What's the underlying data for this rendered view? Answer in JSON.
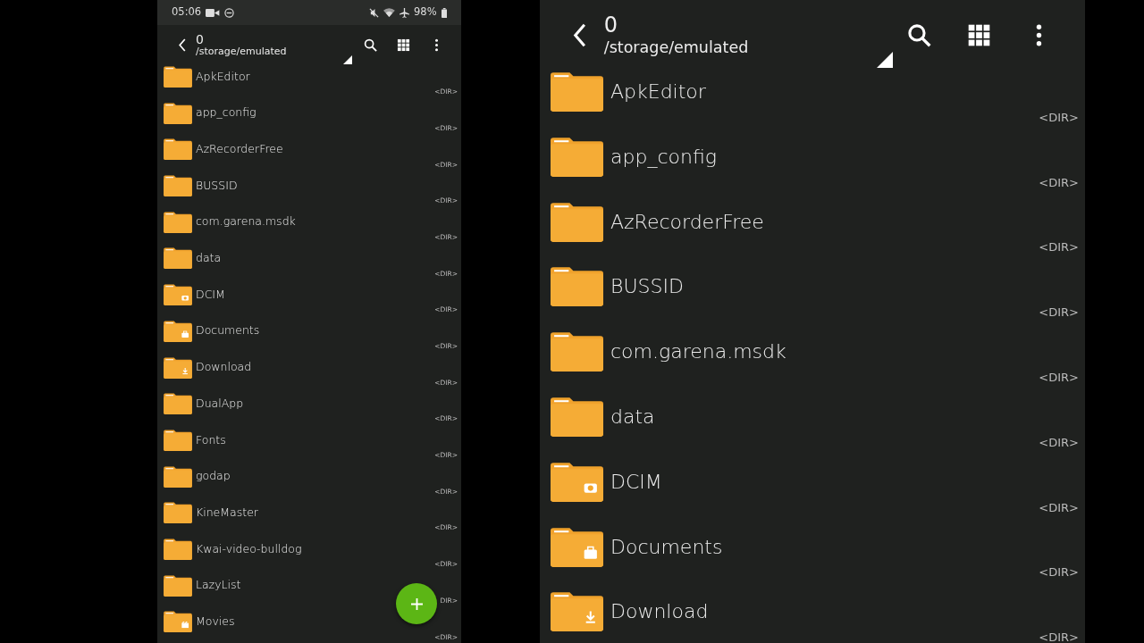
{
  "left_panel": {
    "status_bar": {
      "time": "05:06",
      "battery": "98%"
    },
    "toolbar": {
      "title": "0",
      "path": "/storage/emulated"
    },
    "items": [
      {
        "name": "ApkEditor",
        "badge": "<DIR>",
        "kind": "plain"
      },
      {
        "name": "app_config",
        "badge": "<DIR>",
        "kind": "plain"
      },
      {
        "name": "AzRecorderFree",
        "badge": "<DIR>",
        "kind": "plain"
      },
      {
        "name": "BUSSID",
        "badge": "<DIR>",
        "kind": "plain"
      },
      {
        "name": "com.garena.msdk",
        "badge": "<DIR>",
        "kind": "plain"
      },
      {
        "name": "data",
        "badge": "<DIR>",
        "kind": "plain"
      },
      {
        "name": "DCIM",
        "badge": "<DIR>",
        "kind": "camera"
      },
      {
        "name": "Documents",
        "badge": "<DIR>",
        "kind": "briefcase"
      },
      {
        "name": "Download",
        "badge": "<DIR>",
        "kind": "download"
      },
      {
        "name": "DualApp",
        "badge": "<DIR>",
        "kind": "plain"
      },
      {
        "name": "Fonts",
        "badge": "<DIR>",
        "kind": "plain"
      },
      {
        "name": "godap",
        "badge": "<DIR>",
        "kind": "plain"
      },
      {
        "name": "KineMaster",
        "badge": "<DIR>",
        "kind": "plain"
      },
      {
        "name": "Kwai-video-bulldog",
        "badge": "<DIR>",
        "kind": "plain"
      },
      {
        "name": "LazyList",
        "badge": "DIR>",
        "kind": "plain"
      },
      {
        "name": "Movies",
        "badge": "<DIR>",
        "kind": "film"
      }
    ],
    "fab": {
      "kind": "add"
    }
  },
  "right_panel": {
    "toolbar": {
      "title": "0",
      "path": "/storage/emulated"
    },
    "items": [
      {
        "name": "ApkEditor",
        "badge": "<DIR>",
        "kind": "plain"
      },
      {
        "name": "app_config",
        "badge": "<DIR>",
        "kind": "plain"
      },
      {
        "name": "AzRecorderFree",
        "badge": "<DIR>",
        "kind": "plain"
      },
      {
        "name": "BUSSID",
        "badge": "<DIR>",
        "kind": "plain"
      },
      {
        "name": "com.garena.msdk",
        "badge": "<DIR>",
        "kind": "plain"
      },
      {
        "name": "data",
        "badge": "<DIR>",
        "kind": "plain"
      },
      {
        "name": "DCIM",
        "badge": "<DIR>",
        "kind": "camera"
      },
      {
        "name": "Documents",
        "badge": "<DIR>",
        "kind": "briefcase"
      },
      {
        "name": "Download",
        "badge": "<DIR>",
        "kind": "download"
      }
    ]
  }
}
